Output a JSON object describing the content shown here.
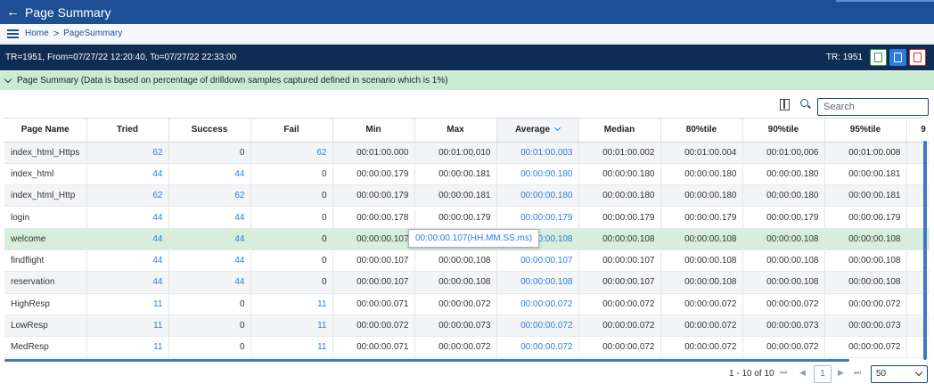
{
  "header": {
    "back_glyph": "←",
    "title": "Page Summary"
  },
  "breadcrumb": {
    "home": "Home",
    "separator": ">",
    "current": "PageSummary"
  },
  "infobar": {
    "range_text": "TR=1951, From=07/27/22 12:20:40, To=07/27/22 22:33:00",
    "tr_label": "TR: 1951",
    "export_icons": [
      "excel-export-icon",
      "word-export-icon",
      "pdf-export-icon"
    ]
  },
  "section": {
    "text": "Page Summary (Data is based on percentage of drilldown samples captured defined in scenario which is 1%)"
  },
  "search": {
    "placeholder": "Search",
    "value": ""
  },
  "table": {
    "columns": [
      "Page Name",
      "Tried",
      "Success",
      "Fail",
      "Min",
      "Max",
      "Average",
      "Median",
      "80%tile",
      "90%tile",
      "95%tile",
      "9"
    ],
    "sorted_column": "Average",
    "rows": [
      [
        "index_html_Https",
        "62",
        "0",
        "62",
        "00:01:00.000",
        "00:01:00.010",
        "00:01:00.003",
        "00:01:00.002",
        "00:01:00.004",
        "00:01:00.006",
        "00:01:00.008"
      ],
      [
        "index_html",
        "44",
        "44",
        "0",
        "00:00:00.179",
        "00:00:00.181",
        "00:00:00.180",
        "00:00:00.180",
        "00:00:00.180",
        "00:00:00.180",
        "00:00:00.181"
      ],
      [
        "index_html_Http",
        "62",
        "62",
        "0",
        "00:00:00.179",
        "00:00:00.181",
        "00:00:00.180",
        "00:00:00.180",
        "00:00:00.180",
        "00:00:00.180",
        "00:00:00.181"
      ],
      [
        "login",
        "44",
        "44",
        "0",
        "00:00:00.178",
        "00:00:00.179",
        "00:00:00.179",
        "00:00:00.179",
        "00:00:00.179",
        "00:00:00.179",
        "00:00:00.179"
      ],
      [
        "welcome",
        "44",
        "44",
        "0",
        "00:00:00.107",
        "",
        ":0:00.108",
        "00:00:00.108",
        "00:00:00.108",
        "00:00:00.108",
        "00:00:00.108"
      ],
      [
        "findflight",
        "44",
        "44",
        "0",
        "00:00:00.107",
        "00:00:00.108",
        "00:00:00.107",
        "00:00:00.107",
        "00:00:00.108",
        "00:00:00.108",
        "00:00:00.108"
      ],
      [
        "reservation",
        "44",
        "44",
        "0",
        "00:00:00.107",
        "00:00:00.108",
        "00:00:00.108",
        "00:00:00.107",
        "00:00:00.108",
        "00:00:00.108",
        "00:00:00.108"
      ],
      [
        "HighResp",
        "11",
        "0",
        "11",
        "00:00:00.071",
        "00:00:00.072",
        "00:00:00.072",
        "00:00:00.072",
        "00:00:00.072",
        "00:00:00.072",
        "00:00:00.072"
      ],
      [
        "LowResp",
        "11",
        "0",
        "11",
        "00:00:00.072",
        "00:00:00.073",
        "00:00:00.072",
        "00:00:00.072",
        "00:00:00.072",
        "00:00:00.073",
        "00:00:00.073"
      ],
      [
        "MedResp",
        "11",
        "0",
        "11",
        "00:00:00.071",
        "00:00:00.072",
        "00:00:00.072",
        "00:00:00.072",
        "00:00:00.072",
        "00:00:00.072",
        "00:00:00.072"
      ]
    ],
    "selected_row": 4,
    "link_color": "#2a7de1",
    "selected_row_color": "#d6eedb"
  },
  "tooltip": {
    "text": "00:00:00.107(HH.MM.SS.ms)"
  },
  "pager": {
    "range": "1 - 10 of 10",
    "first": "⏮",
    "prev": "◀",
    "next": "▶",
    "last": "⏭",
    "page": "1",
    "page_size": "50"
  },
  "colors": {
    "header_bg": "#1e4f95",
    "infobar_bg": "#0f2d52",
    "section_bg": "#c9ebd2",
    "accent": "#2a7de1"
  }
}
